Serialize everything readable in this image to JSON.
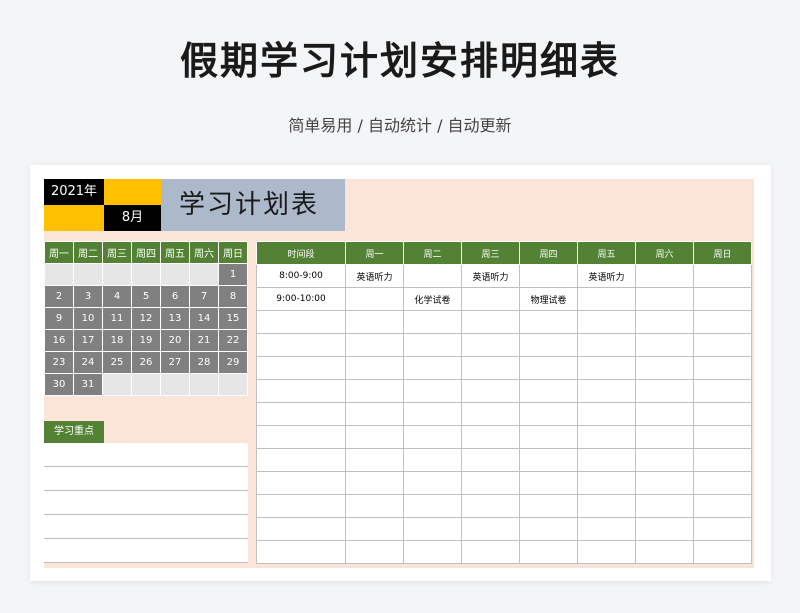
{
  "page": {
    "title": "假期学习计划安排明细表",
    "subtitle": "简单易用 / 自动统计 / 自动更新"
  },
  "sheet": {
    "year": "2021年",
    "month": "8月",
    "plan_title": "学习计划表",
    "calendar": {
      "headers": [
        "周一",
        "周二",
        "周三",
        "周四",
        "周五",
        "周六",
        "周日"
      ],
      "weeks": [
        [
          "",
          "",
          "",
          "",
          "",
          "",
          "1"
        ],
        [
          "2",
          "3",
          "4",
          "5",
          "6",
          "7",
          "8"
        ],
        [
          "9",
          "10",
          "11",
          "12",
          "13",
          "14",
          "15"
        ],
        [
          "16",
          "17",
          "18",
          "19",
          "20",
          "21",
          "22"
        ],
        [
          "23",
          "24",
          "25",
          "26",
          "27",
          "28",
          "29"
        ],
        [
          "30",
          "31",
          "",
          "",
          "",
          "",
          ""
        ]
      ]
    },
    "focus_label": "学习重点",
    "schedule": {
      "headers": [
        "时间段",
        "周一",
        "周二",
        "周三",
        "周四",
        "周五",
        "周六",
        "周日"
      ],
      "rows": [
        [
          "8:00-9:00",
          "英语听力",
          "",
          "英语听力",
          "",
          "英语听力",
          "",
          ""
        ],
        [
          "9:00-10:00",
          "",
          "化学试卷",
          "",
          "物理试卷",
          "",
          "",
          ""
        ],
        [
          "",
          "",
          "",
          "",
          "",
          "",
          "",
          ""
        ],
        [
          "",
          "",
          "",
          "",
          "",
          "",
          "",
          ""
        ],
        [
          "",
          "",
          "",
          "",
          "",
          "",
          "",
          ""
        ],
        [
          "",
          "",
          "",
          "",
          "",
          "",
          "",
          ""
        ],
        [
          "",
          "",
          "",
          "",
          "",
          "",
          "",
          ""
        ],
        [
          "",
          "",
          "",
          "",
          "",
          "",
          "",
          ""
        ],
        [
          "",
          "",
          "",
          "",
          "",
          "",
          "",
          ""
        ],
        [
          "",
          "",
          "",
          "",
          "",
          "",
          "",
          ""
        ],
        [
          "",
          "",
          "",
          "",
          "",
          "",
          "",
          ""
        ],
        [
          "",
          "",
          "",
          "",
          "",
          "",
          "",
          ""
        ],
        [
          "",
          "",
          "",
          "",
          "",
          "",
          "",
          ""
        ]
      ]
    },
    "colors": {
      "green_header": "#548235",
      "yellow": "#ffc000",
      "gray_day": "#808080",
      "title_blue": "#acb9ca",
      "peach_bg": "#fbe5d9"
    }
  }
}
